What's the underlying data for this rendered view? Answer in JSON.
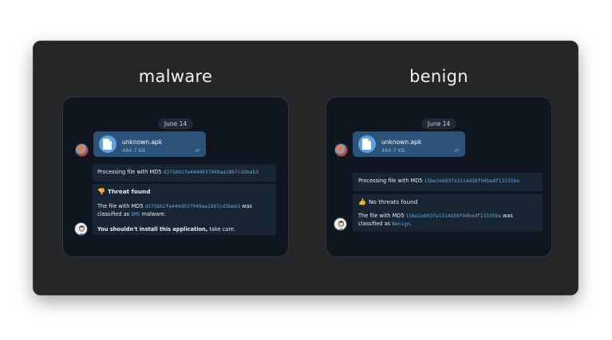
{
  "colors": {
    "card_bg": "#252628",
    "phone_bg": "#0f1620",
    "bubble_out": "#2b5278",
    "bubble_in": "#182533",
    "link": "#6aa4d8"
  },
  "panels": [
    {
      "title": "malware",
      "date": "June 14",
      "file": {
        "name": "unknown.apk",
        "size": "484.7 KB"
      },
      "processing": {
        "prefix": "Processing file with MD5 ",
        "md5": "d3756b2fe444d037049aa1867cd3beb3"
      },
      "result": {
        "icon": "thumbs-down-icon",
        "emoji": "👎",
        "heading": "Threat found",
        "line1_prefix": "The file with MD5 ",
        "line1_md5": "d3756b2fe444d037049aa1867cd3beb3",
        "line1_suffix": " was",
        "line2_prefix": "classified as ",
        "line2_class": "SMS",
        "line2_suffix": " malware.",
        "warning_bold": "You shouldn't install this application,",
        "warning_rest": " take care."
      }
    },
    {
      "title": "benign",
      "date": "June 14",
      "file": {
        "name": "unknown.apk",
        "size": "484.7 KB"
      },
      "processing": {
        "prefix": "Processing file with MD5 ",
        "md5": "15be2e603fa1514d38f04bedf13335ba"
      },
      "result": {
        "icon": "thumbs-up-icon",
        "emoji": "👍",
        "heading": "No threats found",
        "line1_prefix": "The file with MD5 ",
        "line1_md5": "15be2e603fa1514d38f04bedf13335ba",
        "line1_suffix": " was",
        "line2_prefix": "classified as ",
        "line2_class": "Benign",
        "line2_suffix": "."
      }
    }
  ]
}
